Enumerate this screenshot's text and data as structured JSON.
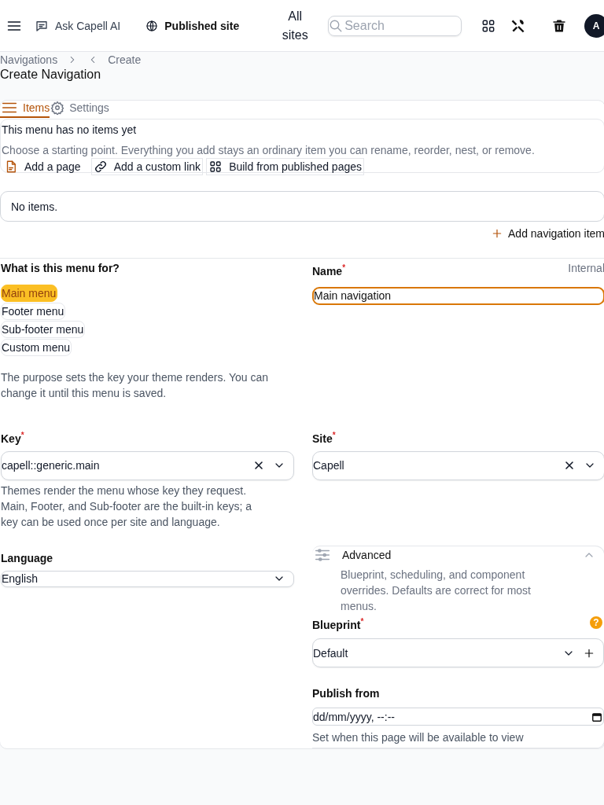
{
  "topbar": {
    "ask_ai": "Ask Capell AI",
    "published_site": "Published site",
    "site_switcher": "All sites",
    "search": {
      "placeholder": "Search"
    },
    "avatar": "A"
  },
  "breadcrumbs": [
    "Navigations",
    "Create"
  ],
  "page_title": "Create Navigation",
  "tabs": [
    {
      "label": "Items",
      "selected": true,
      "kind": "list"
    },
    {
      "label": "Settings",
      "selected": false,
      "kind": "gear"
    }
  ],
  "empty_state": {
    "title": "This menu has no items yet",
    "description": "Choose a starting point. Everything you add stays an ordinary item you can rename, reorder, nest, or remove.",
    "actions": [
      {
        "label": "Add a page",
        "kind": "page"
      },
      {
        "label": "Add a custom link",
        "kind": "link"
      },
      {
        "label": "Build from published pages",
        "kind": "grid"
      }
    ]
  },
  "items_list": {
    "empty_text": "No items.",
    "add_button": "Add navigation item"
  },
  "purpose": {
    "label": "What is this menu for?",
    "options": [
      {
        "label": "Main menu",
        "selected": true
      },
      {
        "label": "Footer menu",
        "selected": false
      },
      {
        "label": "Sub-footer menu",
        "selected": false
      },
      {
        "label": "Custom menu",
        "selected": false
      }
    ],
    "help": "The purpose sets the key your theme renders. You can change it until this menu is saved."
  },
  "name": {
    "label": "Name$^{*}$",
    "hint": "Internal",
    "value": "Main navigation"
  },
  "key": {
    "label": "Key$^{*}$",
    "value": "capell::generic.main",
    "help": "Themes render the menu whose key they request. Main, Footer, and Sub-footer are the built-in keys; a key can be used once per site and language."
  },
  "site": {
    "label": "Site$^{*}$",
    "value": "Capell"
  },
  "language": {
    "label": "Language",
    "value": "English"
  },
  "advanced": {
    "title": "Advanced",
    "description": "Blueprint, scheduling, and component overrides. Defaults are correct for most menus.",
    "expanded": true,
    "blueprint": {
      "label": "Blueprint$^{*}$",
      "value": "Default",
      "help_icon": "?"
    },
    "publish_from": {
      "label": "Publish from",
      "value": "dd/mm/yyyy, --:--",
      "help": "Set when this page will be available to view"
    }
  }
}
